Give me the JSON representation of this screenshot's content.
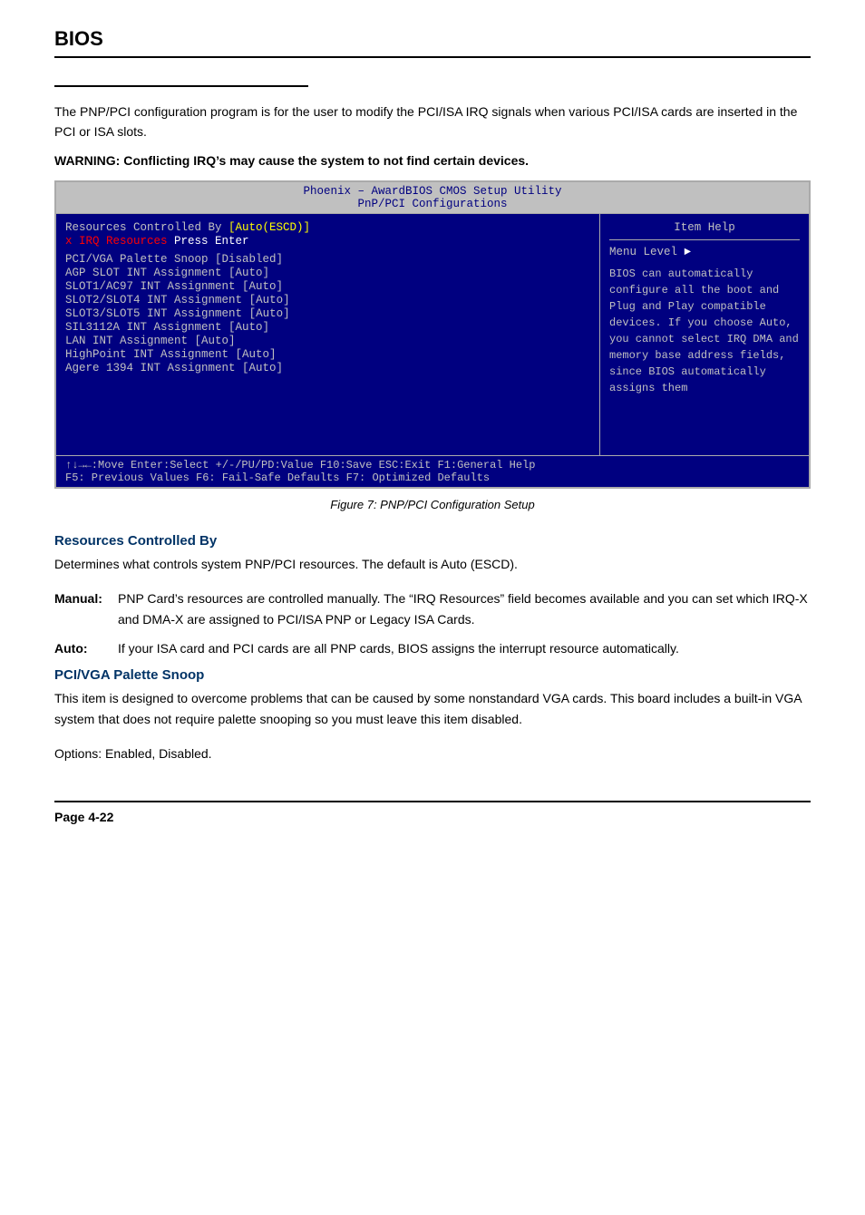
{
  "header": {
    "title": "BIOS"
  },
  "intro": {
    "paragraph": "The PNP/PCI configuration program is for the user to modify the PCI/ISA IRQ signals when various PCI/ISA cards are inserted in the PCI or ISA slots.",
    "warning": "WARNING: Conflicting IRQ’s may cause the system to not find certain devices."
  },
  "bios_screen": {
    "title_line1": "Phoenix – AwardBIOS CMOS Setup Utility",
    "title_line2": "PnP/PCI Configurations",
    "left_panel": {
      "rows": [
        {
          "label": "Resources Controlled By",
          "value": "[Auto(ESCD)]",
          "value_style": "yellow"
        },
        {
          "label": "x IRQ Resources",
          "value": "Press Enter",
          "label_style": "red"
        },
        {
          "label": "",
          "value": ""
        },
        {
          "label": "PCI/VGA Palette Snoop    ",
          "value": "[Disabled]"
        },
        {
          "label": "AGP SLOT INT Assignment  ",
          "value": "[Auto]"
        },
        {
          "label": "SLOT1/AC97 INT Assignment",
          "value": "[Auto]"
        },
        {
          "label": "SLOT2/SLOT4 INT Assignment",
          "value": "[Auto]"
        },
        {
          "label": "SLOT3/SLOT5 INT Assignment",
          "value": "[Auto]"
        },
        {
          "label": "SIL3112A INT Assignment  ",
          "value": "[Auto]"
        },
        {
          "label": "LAN INT Assignment       ",
          "value": "[Auto]"
        },
        {
          "label": "HighPoint INT Assignment ",
          "value": "[Auto]"
        },
        {
          "label": "Agere 1394 INT Assignment",
          "value": "[Auto]"
        }
      ]
    },
    "right_panel": {
      "title": "Item Help",
      "menu_level": "Menu Level",
      "help_text": "BIOS can automatically configure all the boot and Plug and Play compatible devices. If you choose Auto, you cannot select IRQ DMA and memory base address fields, since BIOS automatically assigns them"
    },
    "footer_row1": "↑↓→←:Move  Enter:Select  +/-/PU/PD:Value  F10:Save  ESC:Exit  F1:General Help",
    "footer_row2": "F5: Previous Values    F6: Fail-Safe Defaults    F7: Optimized Defaults"
  },
  "figure_caption": "Figure 7:  PNP/PCI Configuration Setup",
  "sections": [
    {
      "id": "resources-controlled-by",
      "heading": "Resources Controlled By",
      "body": "Determines what controls system PNP/PCI resources. The default is Auto (ESCD).",
      "terms": [
        {
          "label": "Manual:",
          "desc": "PNP Card’s resources are controlled manually. The “IRQ Resources” field becomes available and you can set which IRQ-X and DMA-X are assigned to PCI/ISA PNP or Legacy ISA Cards."
        },
        {
          "label": "Auto:",
          "desc": "If your ISA card and PCI cards are all PNP cards, BIOS assigns the interrupt resource automatically."
        }
      ]
    },
    {
      "id": "pci-vga-palette-snoop",
      "heading": "PCI/VGA Palette Snoop",
      "body": "This item is designed to overcome problems that can be caused by some nonstandard VGA cards. This board includes a built-in VGA system that does not require palette snooping so you must leave this item disabled.",
      "options": "Options: Enabled, Disabled."
    }
  ],
  "footer": {
    "page": "Page 4-22"
  }
}
